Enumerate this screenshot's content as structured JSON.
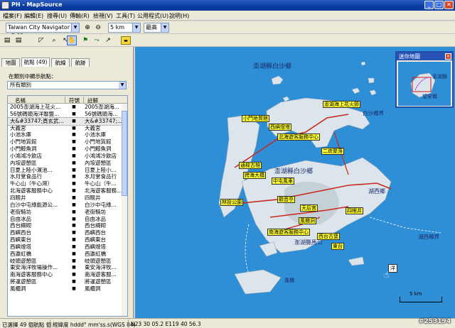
{
  "window": {
    "title": "PH - MapSource"
  },
  "menu": [
    "檔案(F)",
    "編輯(E)",
    "搜尋(U)",
    "傳輸(R)",
    "檢視(V)",
    "工具(T)",
    "公用程式(U)",
    "說明(H)"
  ],
  "toolbar": {
    "map_product": "Taiwan City Navigator v8.01",
    "zoom_scale": "5 km",
    "detail_level": "最高"
  },
  "tabs": [
    {
      "label": "地圖",
      "active": false
    },
    {
      "label": "航點 (49)",
      "active": true
    },
    {
      "label": "航線",
      "active": false
    },
    {
      "label": "航跡",
      "active": false
    }
  ],
  "filter": {
    "label": "在類別中顯示航點：",
    "value": "所有類別"
  },
  "list": {
    "headers": [
      "名稱",
      "符號",
      "註解"
    ],
    "rows": [
      {
        "name": "2005澎湖海上花火...",
        "symbol": "■",
        "comment": "2005澎湖海..."
      },
      {
        "name": "56號碼頭海洋聯盟...",
        "symbol": "■",
        "comment": "56號碼頭海..."
      },
      {
        "name": "大&#33747;頁玄武...",
        "symbol": "■",
        "comment": "大&#33747;...",
        "selected": true
      },
      {
        "name": "大義宮",
        "symbol": "■",
        "comment": "大義宮"
      },
      {
        "name": "小池水庫",
        "symbol": "■",
        "comment": "小池水庫"
      },
      {
        "name": "小門地質館",
        "symbol": "■",
        "comment": "小門地質館"
      },
      {
        "name": "小門鯨魚洞",
        "symbol": "■",
        "comment": "小門鯨魚洞"
      },
      {
        "name": "小鴻鴻冷飲店",
        "symbol": "■",
        "comment": "小鴻鴻冷飲店"
      },
      {
        "name": "內垵遊憩區",
        "symbol": "■",
        "comment": "內垵遊憩區"
      },
      {
        "name": "日夏上陸小濱池...",
        "symbol": "■",
        "comment": "日夏上陸小..."
      },
      {
        "name": "水月堂食品行",
        "symbol": "■",
        "comment": "水月堂食品行"
      },
      {
        "name": "牛心山（牛心灣）",
        "symbol": "■",
        "comment": "牛心山（牛..."
      },
      {
        "name": "北海遊客服務中心",
        "symbol": "■",
        "comment": "北海遊客服務..."
      },
      {
        "name": "四眼井",
        "symbol": "■",
        "comment": "四眼井"
      },
      {
        "name": "白沙中屯綠能源公...",
        "symbol": "■",
        "comment": "白沙中屯綠..."
      },
      {
        "name": "老街騎坊",
        "symbol": "■",
        "comment": "老街騎坊"
      },
      {
        "name": "自由冰品",
        "symbol": "■",
        "comment": "自由冰品"
      },
      {
        "name": "西台綱砌",
        "symbol": "■",
        "comment": "西台綱砌"
      },
      {
        "name": "西嶼西台",
        "symbol": "■",
        "comment": "西嶼西台"
      },
      {
        "name": "西嶼東台",
        "symbol": "■",
        "comment": "西嶼東台"
      },
      {
        "name": "西嶼燈塔",
        "symbol": "■",
        "comment": "西嶼燈塔"
      },
      {
        "name": "西瀛虹橋",
        "symbol": "■",
        "comment": "西瀛虹橋"
      },
      {
        "name": "岐頭遊憩區",
        "symbol": "■",
        "comment": "岐頭遊憩區"
      },
      {
        "name": "東安海洋牧場操作...",
        "symbol": "■",
        "comment": "東安海洋牧..."
      },
      {
        "name": "南海遊客服務中心",
        "symbol": "■",
        "comment": "南海遊客服..."
      },
      {
        "name": "將運遊憩區",
        "symbol": "■",
        "comment": "將運遊憩區"
      },
      {
        "name": "風櫃洞",
        "symbol": "■",
        "comment": "風櫃洞"
      }
    ]
  },
  "map": {
    "labels": {
      "white_sand_upper": "澎湖縣白沙鄉",
      "white_sand_mid": "澎湖縣白沙鄉",
      "white_sand_right": "白沙鄉界",
      "huxi": "湖西鄉",
      "huxi_border": "湖西鄉界",
      "magong": "澎湖縣馬公",
      "fengkui": "風櫃",
      "scale": "5 km",
      "cursor_label": "洋"
    },
    "waypoint_labels": [
      "澎湖海上花火節",
      "小門地質館",
      "西嶼燈塔",
      "北海遊客服務中心",
      "二崁聚落",
      "通樑古榕",
      "跨海大橋",
      "中屯風車",
      "林投公園",
      "觀音亭",
      "天后宮",
      "四眼井",
      "風櫃洞",
      "南海遊客服務中心",
      "西台古堡",
      "東台"
    ],
    "colors": {
      "sea": "#2f8fd6",
      "land": "#dde5ec",
      "road": "#c8281e",
      "label_bg": "#ffff33"
    }
  },
  "minimap": {
    "title": "迷你地圖",
    "labels": [
      "澎湖縣",
      "望安鄉"
    ]
  },
  "status": {
    "selected": "已選擇 49 個航點 個",
    "format": "經緯度 hddd° mm'ss.s(WGS 84)",
    "coords": "N23 30 05.2 E119 40 56.3"
  },
  "watermark": "#253194"
}
